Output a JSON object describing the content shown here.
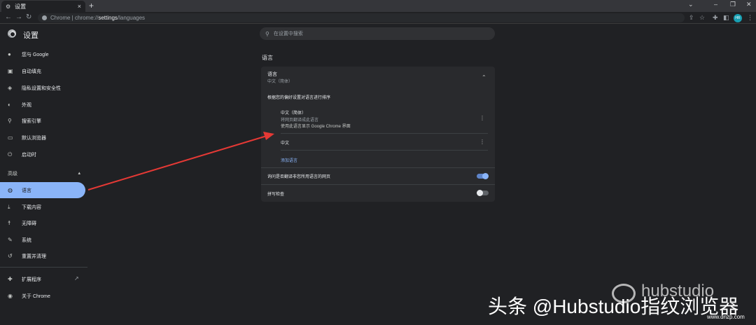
{
  "browser": {
    "tab_title": "设置",
    "tab_icon": "gear-icon",
    "new_tab": "+",
    "url_host": "Chrome",
    "url_sep": " | ",
    "url_scheme": "chrome://",
    "url_path_bold": "settings",
    "url_path_rest": "/languages",
    "profile_initials": "HR"
  },
  "settings": {
    "title": "设置",
    "search_placeholder": "在设置中搜索"
  },
  "sidebar": {
    "items": [
      {
        "label": "您与 Google",
        "icon": "person-icon"
      },
      {
        "label": "自动填充",
        "icon": "clipboard-icon"
      },
      {
        "label": "隐私设置和安全性",
        "icon": "shield-icon"
      },
      {
        "label": "外观",
        "icon": "palette-icon"
      },
      {
        "label": "搜索引擎",
        "icon": "search-icon"
      },
      {
        "label": "默认浏览器",
        "icon": "browser-icon"
      },
      {
        "label": "启动时",
        "icon": "power-icon"
      }
    ],
    "advanced_label": "高级",
    "advanced_items": [
      {
        "label": "语言",
        "icon": "globe-icon"
      },
      {
        "label": "下载内容",
        "icon": "download-icon"
      },
      {
        "label": "无障碍",
        "icon": "accessibility-icon"
      },
      {
        "label": "系统",
        "icon": "wrench-icon"
      },
      {
        "label": "重置并清理",
        "icon": "restore-icon"
      }
    ],
    "extensions_label": "扩展程序",
    "about_label": "关于 Chrome"
  },
  "main": {
    "section_title": "语言",
    "language_row_label": "语言",
    "language_row_value": "中文（简体）",
    "order_hint": "根据您的偏好设置对语言进行排序",
    "languages": [
      {
        "name": "中文（简体）",
        "line2": "将网页翻译成此语言",
        "line3": "使用此语言显示 Google Chrome 界面"
      },
      {
        "name": "中文",
        "line2": "",
        "line3": ""
      }
    ],
    "add_language": "添加语言",
    "translate_label": "询问是否翻译非您所用语言的网页",
    "translate_on": true,
    "spellcheck_label": "拼写检查",
    "spellcheck_on": false
  },
  "watermark": {
    "brand": "hubstudio",
    "line": "头条 @Hubstudio指纹浏览器",
    "site": "www.dnzp.com"
  },
  "colors": {
    "accent": "#8ab4f8",
    "background": "#202124",
    "card": "#292a2d",
    "arrow": "#e53935"
  }
}
